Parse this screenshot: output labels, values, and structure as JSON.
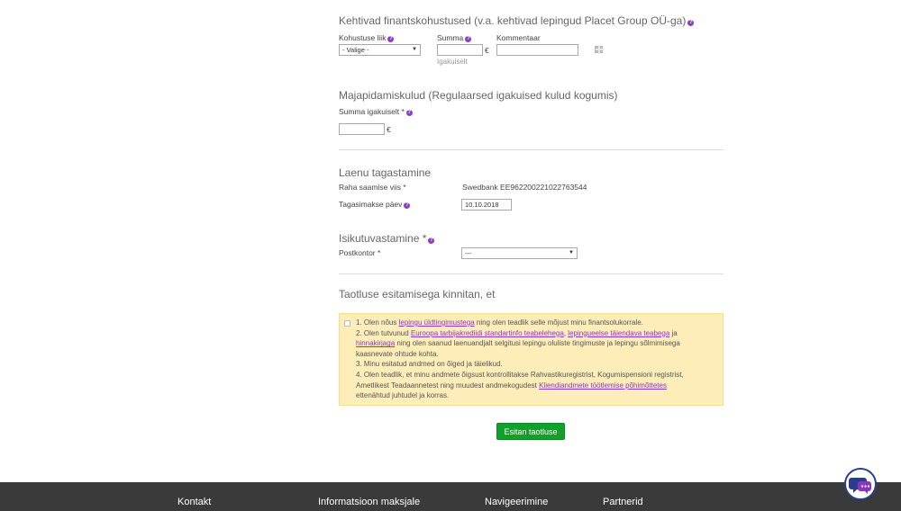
{
  "financial": {
    "title": "Kehtivad finantskohustused (v.a. kehtivad lepingud Placet Group OÜ-ga)",
    "type_label": "Kohustuse liik",
    "type_value": "- Valige -",
    "sum_label": "Summa",
    "sum_hint": "Igakuiselt",
    "comment_label": "Kommentaar",
    "currency": "€"
  },
  "household": {
    "title": "Majapidamiskulud (Regulaarsed igakuised kulud kogumis)",
    "sum_label": "Summa igakuiselt *",
    "currency": "€"
  },
  "repayment": {
    "title": "Laenu tagastamine",
    "method_label": "Raha saamise viis *",
    "method_value": "Swedbank EE962200221022763544",
    "date_label": "Tagasimakse päev",
    "date_value": "10.10.2018"
  },
  "identity": {
    "title": "Isikutuvastamine *",
    "postoffice_label": "Postkontor *",
    "postoffice_value": "---"
  },
  "confirm": {
    "title": "Taotluse esitamisega kinnitan, et",
    "line1_a": "1. Olen nõus ",
    "line1_link": "lepingu üldtingimustega",
    "line1_b": " ning olen teadlik selle mõjust minu finantsolukorrale.",
    "line2_a": "2. Olen tutvunud ",
    "line2_link1": "Euroopa tarbijakrediidi standartinfo teabelehega",
    "line2_sep": ", ",
    "line2_link2": "lepingueelse täiendava teabega",
    "line2_b": " ja",
    "line2_link3": "hinnakirjaga",
    "line2_c": " ning olen saanud laenuandjalt selgitusi lepingu oluliste tingimuste ja lepingu sõlmimisega",
    "line2_d": "kaasnevate ohtude kohta.",
    "line3": "3. Minu esitatud andmed on õiged ja täielikud.",
    "line4_a": "4. Olen teadlik, et minu andmete õigsust kontrollitakse Rahvastikuregistrist, Kogumispensioni registrist,",
    "line4_b": "Ametlikest Teadaannetest ning muudest andmekogudest ",
    "line4_link": "Kliendiandmete töötlemise põhimõttetes",
    "line4_c": "ettenähtud juhtudel ja korras."
  },
  "submit_label": "Esitan taotluse",
  "footer": {
    "col1": "Kontakt",
    "col2": "Informatsioon maksjale",
    "col3": "Navigeerimine",
    "col4": "Partnerid"
  },
  "colors": {
    "accent": "#8e35c0",
    "submit": "#11a02b",
    "notice_bg": "#fdedb8",
    "footer_bg": "#3a3a3a"
  }
}
